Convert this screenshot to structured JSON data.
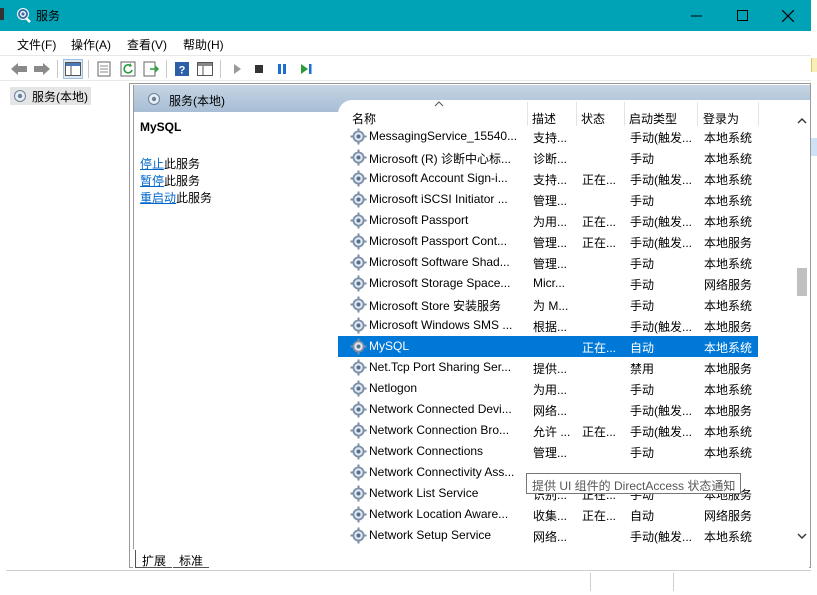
{
  "window": {
    "title": "服务"
  },
  "menubar": [
    "文件(F)",
    "操作(A)",
    "查看(V)",
    "帮助(H)"
  ],
  "toolbar": {
    "icons": [
      "back-arrow-icon",
      "forward-arrow-icon",
      "show-console-tree-icon",
      "properties-icon",
      "refresh-icon",
      "export-list-icon",
      "help-icon",
      "standard-view-icon",
      "start-service-icon",
      "stop-service-icon",
      "pause-service-icon",
      "restart-service-icon"
    ]
  },
  "tree": {
    "root_label": "服务(本地)"
  },
  "pane": {
    "header_title": "服务(本地)",
    "selected_service": "MySQL",
    "actions": [
      {
        "link": "停止",
        "suffix": "此服务"
      },
      {
        "link": "暂停",
        "suffix": "此服务"
      },
      {
        "link": "重启动",
        "suffix": "此服务"
      }
    ]
  },
  "columns": [
    "名称",
    "描述",
    "状态",
    "启动类型",
    "登录为"
  ],
  "services": [
    {
      "name": "MessagingService_15540...",
      "desc": "支持...",
      "state": "",
      "start": "手动(触发...",
      "login": "本地系统"
    },
    {
      "name": "Microsoft (R) 诊断中心标...",
      "desc": "诊断...",
      "state": "",
      "start": "手动",
      "login": "本地系统"
    },
    {
      "name": "Microsoft Account Sign-i...",
      "desc": "支持...",
      "state": "正在...",
      "start": "手动(触发...",
      "login": "本地系统"
    },
    {
      "name": "Microsoft iSCSI Initiator ...",
      "desc": "管理...",
      "state": "",
      "start": "手动",
      "login": "本地系统"
    },
    {
      "name": "Microsoft Passport",
      "desc": "为用...",
      "state": "正在...",
      "start": "手动(触发...",
      "login": "本地系统"
    },
    {
      "name": "Microsoft Passport Cont...",
      "desc": "管理...",
      "state": "正在...",
      "start": "手动(触发...",
      "login": "本地服务"
    },
    {
      "name": "Microsoft Software Shad...",
      "desc": "管理...",
      "state": "",
      "start": "手动",
      "login": "本地系统"
    },
    {
      "name": "Microsoft Storage Space...",
      "desc": "Micr...",
      "state": "",
      "start": "手动",
      "login": "网络服务"
    },
    {
      "name": "Microsoft Store 安装服务",
      "desc": "为 M...",
      "state": "",
      "start": "手动",
      "login": "本地系统"
    },
    {
      "name": "Microsoft Windows SMS ...",
      "desc": "根据...",
      "state": "",
      "start": "手动(触发...",
      "login": "本地服务"
    },
    {
      "name": "MySQL",
      "desc": "",
      "state": "正在...",
      "start": "自动",
      "login": "本地系统",
      "selected": true
    },
    {
      "name": "Net.Tcp Port Sharing Ser...",
      "desc": "提供...",
      "state": "",
      "start": "禁用",
      "login": "本地服务"
    },
    {
      "name": "Netlogon",
      "desc": "为用...",
      "state": "",
      "start": "手动",
      "login": "本地系统"
    },
    {
      "name": "Network Connected Devi...",
      "desc": "网络...",
      "state": "",
      "start": "手动(触发...",
      "login": "本地服务"
    },
    {
      "name": "Network Connection Bro...",
      "desc": "允许 ...",
      "state": "正在...",
      "start": "手动(触发...",
      "login": "本地系统"
    },
    {
      "name": "Network Connections",
      "desc": "管理...",
      "state": "",
      "start": "手动",
      "login": "本地系统"
    },
    {
      "name": "Network Connectivity Ass...",
      "desc": "",
      "state": "",
      "start": "",
      "login": ""
    },
    {
      "name": "Network List Service",
      "desc": "识别...",
      "state": "正在...",
      "start": "手动",
      "login": "本地服务"
    },
    {
      "name": "Network Location Aware...",
      "desc": "收集...",
      "state": "正在...",
      "start": "自动",
      "login": "网络服务"
    },
    {
      "name": "Network Setup Service",
      "desc": "网络...",
      "state": "",
      "start": "手动(触发...",
      "login": "本地系统"
    }
  ],
  "tooltip": "提供 UI 组件的 DirectAccess 状态通知",
  "tabs": [
    "扩展",
    "标准"
  ],
  "colors": {
    "titlebar": "#00a2b6",
    "selection": "#0078d7",
    "link": "#0066cc"
  }
}
